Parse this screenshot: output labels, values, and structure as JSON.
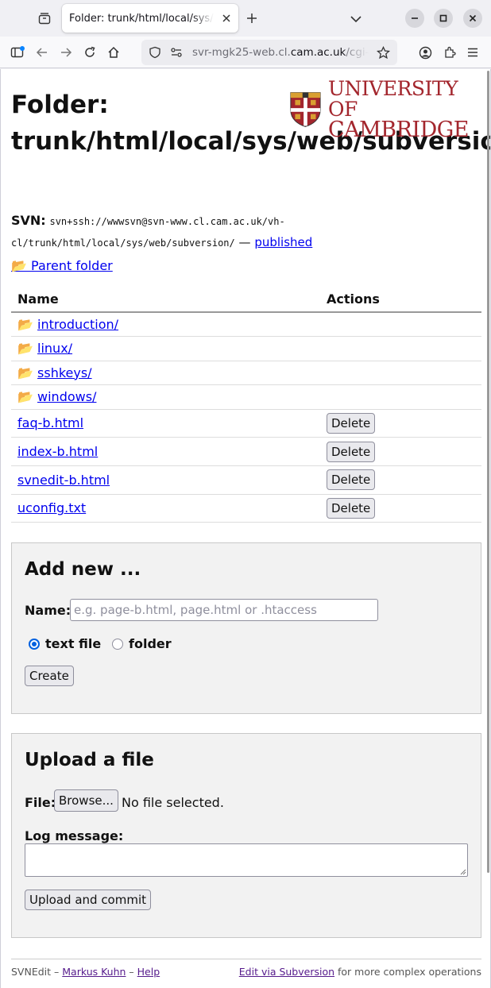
{
  "browser": {
    "tab_title": "Folder: trunk/html/local/sys/web/subversion/",
    "url_host": "svr-mgk25-web.cl.cam.ac.uk",
    "url_rest": "/cgi-bin/svnedit",
    "url_prefix": "svr-mgk25-web.cl."
  },
  "page": {
    "title": "Folder: trunk/html/local/sys/web/subversion/",
    "logo_line1": "UNIVERSITY OF",
    "logo_line2": "CAMBRIDGE",
    "svn_label": "SVN:",
    "svn_url": "svn+ssh://wwwsvn@svn-www.cl.cam.ac.uk/vh-cl/trunk/html/local/sys/web/subversion/",
    "svn_sep": " — ",
    "published_link": "published",
    "parent_folder": "📂 Parent folder",
    "table": {
      "headers": [
        "Name",
        "Actions"
      ],
      "folders": [
        "introduction/",
        "linux/",
        "sshkeys/",
        "windows/"
      ],
      "files": [
        "faq-b.html",
        "index-b.html",
        "svnedit-b.html",
        "uconfig.txt"
      ],
      "delete_label": "Delete"
    },
    "add_new": {
      "heading": "Add new ...",
      "name_label": "Name:",
      "name_placeholder": "e.g. page-b.html, page.html or .htaccess",
      "radio_text_file": "text file",
      "radio_folder": "folder",
      "create_button": "Create"
    },
    "upload": {
      "heading": "Upload a file",
      "file_label": "File:",
      "browse_button": "Browse...",
      "no_file": "No file selected.",
      "log_label": "Log message:",
      "submit_button": "Upload and commit"
    },
    "footer": {
      "app_name": "SVNEdit",
      "dash1": " – ",
      "author_link": "Markus Kuhn",
      "dash2": " – ",
      "help_link": "Help",
      "svn_link": "Edit via Subversion",
      "svn_suffix": " for more complex operations"
    }
  },
  "colors": {
    "brand_red": "#a3262d",
    "link": "#0000ee",
    "visited": "#551a8b",
    "radio_accent": "#0061e0"
  }
}
